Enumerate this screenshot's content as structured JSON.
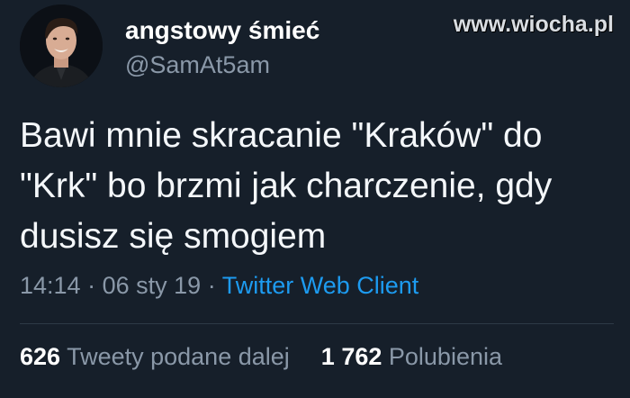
{
  "watermark": "www.wiocha.pl",
  "user": {
    "display_name": "angstowy śmieć",
    "handle": "@SamAt5am",
    "avatar_icon": "profile-photo"
  },
  "tweet": {
    "text": "Bawi mnie skracanie \"Kraków\" do\n\"Krk\" bo brzmi jak charczenie, gdy\ndusisz się smogiem"
  },
  "meta": {
    "time": "14:14",
    "separator": "·",
    "date": "06 sty 19",
    "source": "Twitter Web Client"
  },
  "stats": {
    "retweets_count": "626",
    "retweets_label": "Tweety podane dalej",
    "likes_count": "1 762",
    "likes_label": "Polubienia"
  },
  "colors": {
    "background": "#161f2a",
    "link": "#1d9bf0",
    "muted": "#8a98a8"
  }
}
